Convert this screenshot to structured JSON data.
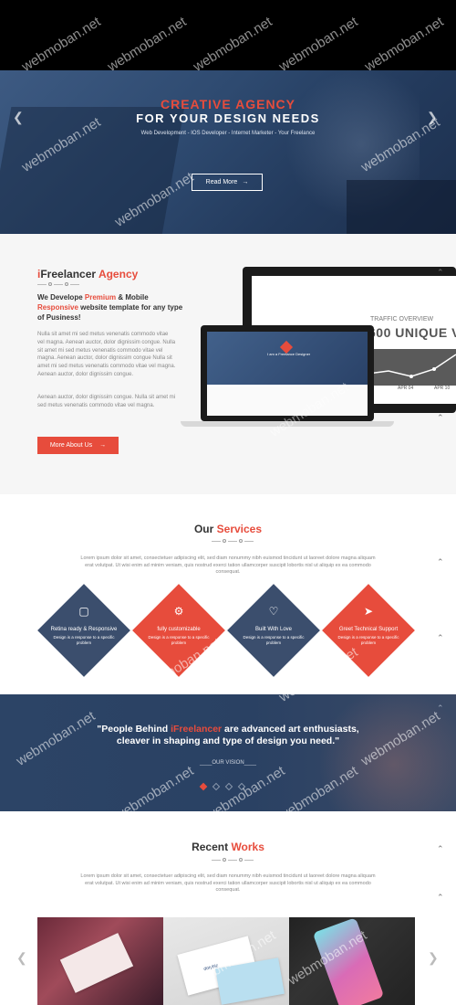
{
  "hero": {
    "title_line1": "CREATIVE AGENCY",
    "title_line2": "FOR YOUR DESIGN NEEDS",
    "subtitle": "Web Development - IOS Developer - Internet Marketer - Your Freelance",
    "cta_label": "Read More",
    "cta_icon": "arrow-right-icon",
    "prev_icon": "chevron-left-icon",
    "next_icon": "chevron-right-icon"
  },
  "watermark": "webmoban.net",
  "agency": {
    "title_prefix": "i",
    "title_brand": "Freelancer",
    "title_suffix": "Agency",
    "lead": {
      "part1": "We Develope ",
      "highlight1": "Premium",
      "part2": " & Mobile ",
      "highlight2": "Responsive",
      "part3": " website template for any type of Pusiness!"
    },
    "paragraph1": "Nulla sit amet mi sed metus venenatis commodo vitae vel magna. Aenean auctor, dolor dignissim congue. Nulla sit amet mi sed metus venenatis commodo vitae vel magna. Aenean auctor, dolor dignissim congue Nulla sit amet mi sed metus venenatis commodo vitae vel magna. Aenean auctor, dolor dignissim congue.",
    "paragraph2": "Aenean auctor, dolor dignissim congue. Nulla sit amet mi sed metus venenatis commodo vitae vel magna.",
    "button_label": "More About Us",
    "button_icon": "arrow-right-icon",
    "monitor": {
      "label": "TRAFFIC OVERVIEW",
      "headline": "600 UNIQUE V",
      "axis_1": "APR 04",
      "axis_2": "APR 10"
    },
    "laptop": {
      "caption": "I am a Freelance Designer"
    }
  },
  "services": {
    "title_plain": "Our ",
    "title_accent": "Services",
    "intro": "Lorem ipsum dolor sit amet, consectetuer adipiscing elit, sed diam nonummy nibh euismod tincidunt ut laoreet dolore magna aliquam erat volutpat. Ut wisi enim ad minim veniam, quis nostrud exerci tation ullamcorper suscipit lobortis nisl ut aliquip ex ea commodo consequat.",
    "items": [
      {
        "title": "Retina ready & Responsive",
        "text": "Design is a response to a specific problem",
        "icon": "mobile-icon",
        "color": "#3b4e6d"
      },
      {
        "title": "fully customizable",
        "text": "Design is a response to a specific problem",
        "icon": "gear-icon",
        "color": "#e74c3c"
      },
      {
        "title": "Built With Love",
        "text": "Design is a response to a specific problem",
        "icon": "heart-icon",
        "color": "#3b4e6d"
      },
      {
        "title": "Greet Technical Support",
        "text": "Design is a response to a specific problem",
        "icon": "rocket-icon",
        "color": "#e74c3c"
      }
    ]
  },
  "quote": {
    "part1": "\"People Behind ",
    "highlight": "iFreelancer",
    "part2": " are advanced art enthusiasts,",
    "line2": "cleaver in shaping and type of design you need.\"",
    "vision": "OUR VISION"
  },
  "works": {
    "title_plain": "Recent ",
    "title_accent": "Works",
    "intro": "Lorem ipsum dolor sit amet, consectetuer adipiscing elit, sed diam nonummy nibh euismod tincidunt ut laoreet dolore magna aliquam erat volutpat. Ut wisi enim ad minim veniam, quis nostrud exerci tation ullamcorper suscipit lobortis nisl ut aliquip ex ea commodo consequat.",
    "card_text": "dorybiz"
  },
  "colors": {
    "accent": "#e74c3c",
    "navy": "#3b4e6d"
  }
}
